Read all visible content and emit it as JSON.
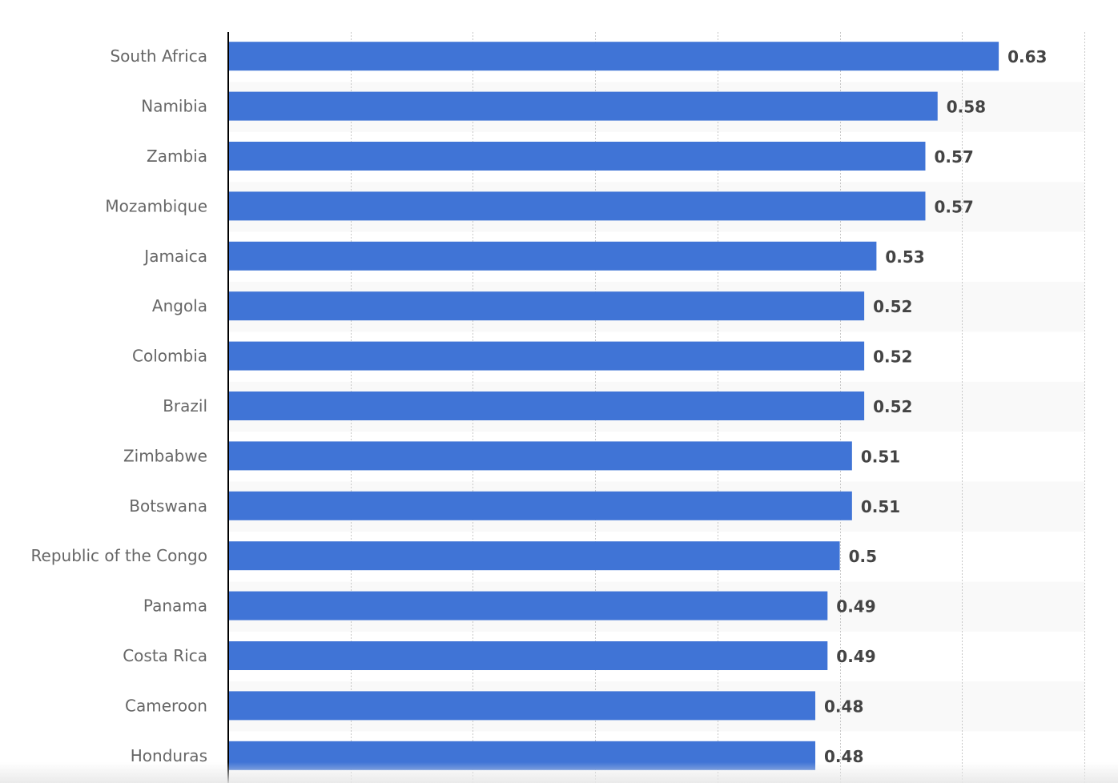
{
  "chart_data": {
    "type": "bar",
    "orientation": "horizontal",
    "title": "",
    "xlabel": "",
    "ylabel": "",
    "categories": [
      "South Africa",
      "Namibia",
      "Zambia",
      "Mozambique",
      "Jamaica",
      "Angola",
      "Colombia",
      "Brazil",
      "Zimbabwe",
      "Botswana",
      "Republic of the Congo",
      "Panama",
      "Costa Rica",
      "Cameroon",
      "Honduras"
    ],
    "values": [
      0.63,
      0.58,
      0.57,
      0.57,
      0.53,
      0.52,
      0.52,
      0.52,
      0.51,
      0.51,
      0.5,
      0.49,
      0.49,
      0.48,
      0.48
    ],
    "value_labels": [
      "0.63",
      "0.58",
      "0.57",
      "0.57",
      "0.53",
      "0.52",
      "0.52",
      "0.52",
      "0.51",
      "0.51",
      "0.5",
      "0.49",
      "0.49",
      "0.48",
      "0.48"
    ],
    "xlim": [
      0,
      0.7
    ],
    "grid_step": 0.1,
    "grid": true,
    "legend": "none",
    "colors": {
      "bar": "#4074d6",
      "band": "#f9f9f9",
      "gridline": "#c8c8c8",
      "axis": "#000000"
    }
  }
}
